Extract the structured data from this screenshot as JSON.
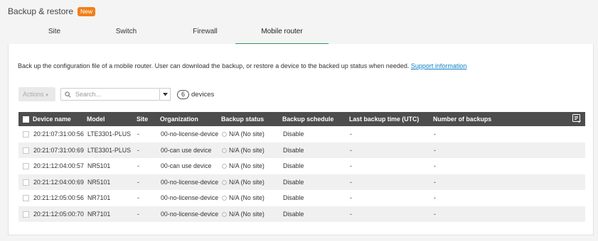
{
  "header": {
    "title": "Backup & restore",
    "badge": "New"
  },
  "tabs": [
    {
      "label": "Site"
    },
    {
      "label": "Switch"
    },
    {
      "label": "Firewall"
    },
    {
      "label": "Mobile router",
      "active": true
    }
  ],
  "description": {
    "text": "Back up the configuration file of a mobile router. User can download the backup, or restore a device to the backed up status when needed.",
    "link": "Support information"
  },
  "toolbar": {
    "actions_label": "Actions",
    "search_placeholder": "Search...",
    "device_count": "6",
    "device_count_label": "devices"
  },
  "table": {
    "columns": [
      "Device name",
      "Model",
      "Site",
      "Organization",
      "Backup status",
      "Backup schedule",
      "Last backup time (UTC)",
      "Number of backups"
    ],
    "rows": [
      [
        "20:21:07:31:00:56",
        "LTE3301-PLUS",
        "-",
        "00-no-license-device",
        "N/A (No site)",
        "Disable",
        "-",
        "-"
      ],
      [
        "20:21:07:31:00:69",
        "LTE3301-PLUS",
        "-",
        "00-can use device",
        "N/A (No site)",
        "Disable",
        "-",
        "-"
      ],
      [
        "20:21:12:04:00:57",
        "NR5101",
        "-",
        "00-can use device",
        "N/A (No site)",
        "Disable",
        "-",
        "-"
      ],
      [
        "20:21:12:04:00:69",
        "NR5101",
        "-",
        "00-no-license-device",
        "N/A (No site)",
        "Disable",
        "-",
        "-"
      ],
      [
        "20:21:12:05:00:56",
        "NR7101",
        "-",
        "00-no-license-device",
        "N/A (No site)",
        "Disable",
        "-",
        "-"
      ],
      [
        "20:21:12:05:00:70",
        "NR7101",
        "-",
        "00-no-license-device",
        "N/A (No site)",
        "Disable",
        "-",
        "-"
      ]
    ]
  },
  "colors": {
    "accent": "#2a9b5b",
    "badge": "#f07f1a",
    "header_bg": "#4d4d4d",
    "link": "#0e7fc6"
  },
  "icons": {
    "search": "search-icon",
    "dropdown": "chevron-down-icon",
    "column_settings": "column-settings-icon"
  }
}
